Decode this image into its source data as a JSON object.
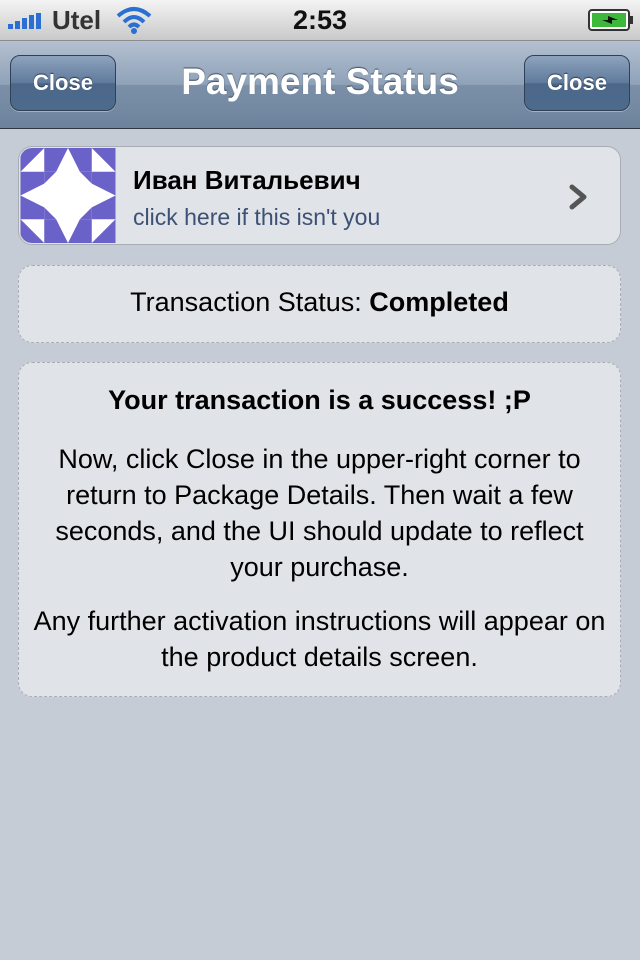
{
  "status_bar": {
    "carrier": "Utel",
    "time": "2:53",
    "icons": [
      "signal-bars-icon",
      "wifi-icon",
      "battery-charging-icon"
    ],
    "battery_color": "#3db83a"
  },
  "nav": {
    "title": "Payment Status",
    "left_button": "Close",
    "right_button": "Close",
    "tint": "#6d839c"
  },
  "user": {
    "name": "Иван Витальевич",
    "subtitle": "click here if this isn't you",
    "avatar_icon": "identicon",
    "avatar_color": "#6a62c8",
    "accessory_icon": "chevron-right-icon"
  },
  "transaction": {
    "label": "Transaction Status:",
    "value": "Completed"
  },
  "message": {
    "heading": "Your transaction is a success! ;P",
    "paragraph1": "Now, click Close in the upper-right corner to return to Package Details. Then wait a few seconds, and the UI should update to reflect your purchase.",
    "paragraph2": "Any further activation instructions will appear on the product details screen."
  }
}
